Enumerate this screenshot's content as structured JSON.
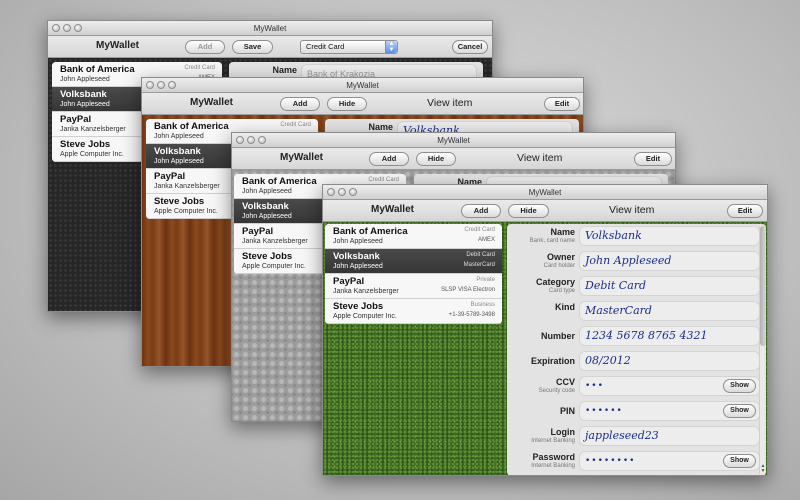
{
  "app_title": "MyWallet",
  "windows": {
    "w1": {
      "title": "MyWallet",
      "toolbar_title": "MyWallet",
      "add": "Add",
      "save": "Save",
      "category_select": "Credit Card",
      "cancel": "Cancel",
      "name_label": "Name",
      "name_value": "Bank of Krakozia"
    },
    "w2": {
      "title": "MyWallet",
      "toolbar_title": "MyWallet",
      "add": "Add",
      "hide": "Hide",
      "view_title": "View item",
      "edit": "Edit",
      "name_label": "Name",
      "name_value": "Volksbank"
    },
    "w3": {
      "title": "MyWallet",
      "toolbar_title": "MyWallet",
      "add": "Add",
      "hide": "Hide",
      "view_title": "View item",
      "edit": "Edit",
      "name_label": "Name"
    },
    "w4": {
      "title": "MyWallet",
      "toolbar_title": "MyWallet",
      "add": "Add",
      "hide": "Hide",
      "view_title": "View item",
      "edit": "Edit"
    }
  },
  "items": [
    {
      "name": "Bank of America",
      "owner": "John Appleseed",
      "category": "Credit Card",
      "detail": "AMEX"
    },
    {
      "name": "Volksbank",
      "owner": "John Appleseed",
      "category": "Debit Card",
      "detail": "MasterCard"
    },
    {
      "name": "PayPal",
      "owner": "Janka Kanzelsberger",
      "category": "Private",
      "detail": "SLSP VISA Electron"
    },
    {
      "name": "Steve Jobs",
      "owner": "Apple Computer Inc.",
      "category": "Business",
      "detail": "+1-39-5789-3498"
    }
  ],
  "fields": [
    {
      "label": "Name",
      "sub": "Bank, card name",
      "value": "Volksbank"
    },
    {
      "label": "Owner",
      "sub": "Card holder",
      "value": "John Appleseed"
    },
    {
      "label": "Category",
      "sub": "Card type",
      "value": "Debit Card"
    },
    {
      "label": "Kind",
      "sub": "",
      "value": "MasterCard"
    },
    {
      "label": "Number",
      "sub": "",
      "value": "1234 5678 8765 4321"
    },
    {
      "label": "Expiration",
      "sub": "",
      "value": "08/2012"
    },
    {
      "label": "CCV",
      "sub": "Security code",
      "value": "•••",
      "show": "Show"
    },
    {
      "label": "PIN",
      "sub": "",
      "value": "••••••",
      "show": "Show"
    },
    {
      "label": "Login",
      "sub": "Internet Banking",
      "value": "jappleseed23"
    },
    {
      "label": "Password",
      "sub": "Internet Banking",
      "value": "••••••••",
      "show": "Show"
    }
  ]
}
